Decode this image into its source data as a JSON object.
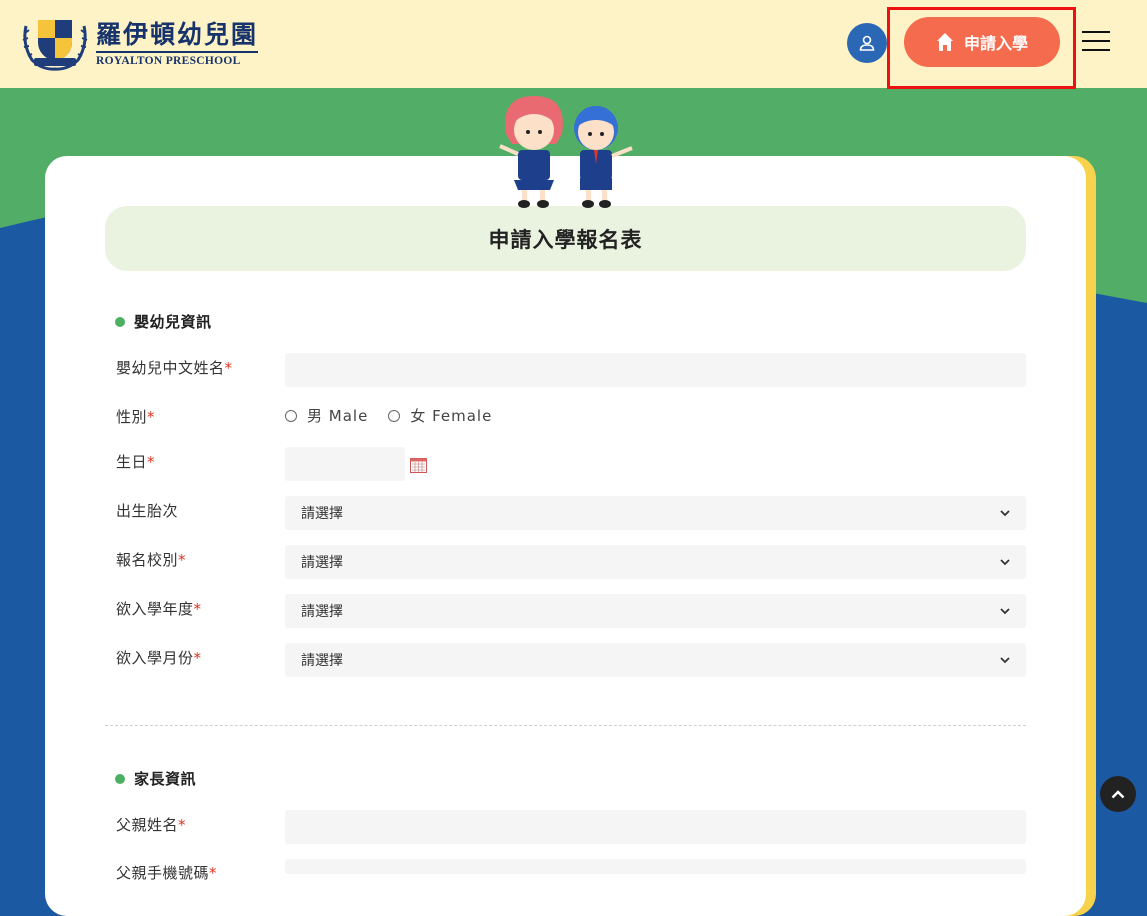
{
  "header": {
    "logo_cn": "羅伊頓幼兒園",
    "logo_en": "ROYALTON PRESCHOOL",
    "apply_label": "申請入學"
  },
  "form": {
    "title": "申請入學報名表",
    "child_section": "嬰幼兒資訊",
    "fields": {
      "child_name": "嬰幼兒中文姓名",
      "gender": "性別",
      "gender_male": "男 Male",
      "gender_female": "女 Female",
      "birthday": "生日",
      "birth_order": "出生胎次",
      "campus": "報名校別",
      "school_year": "欲入學年度",
      "entry_month": "欲入學月份"
    },
    "select_placeholder": "請選擇",
    "parent_section": "家長資訊",
    "father_name": "父親姓名",
    "father_phone": "父親手機號碼"
  },
  "colors": {
    "header_bg": "#fdf3c6",
    "accent": "#f56b4d",
    "green": "#52ad66",
    "blue": "#1b5aa2",
    "yellow": "#f7d24c"
  }
}
